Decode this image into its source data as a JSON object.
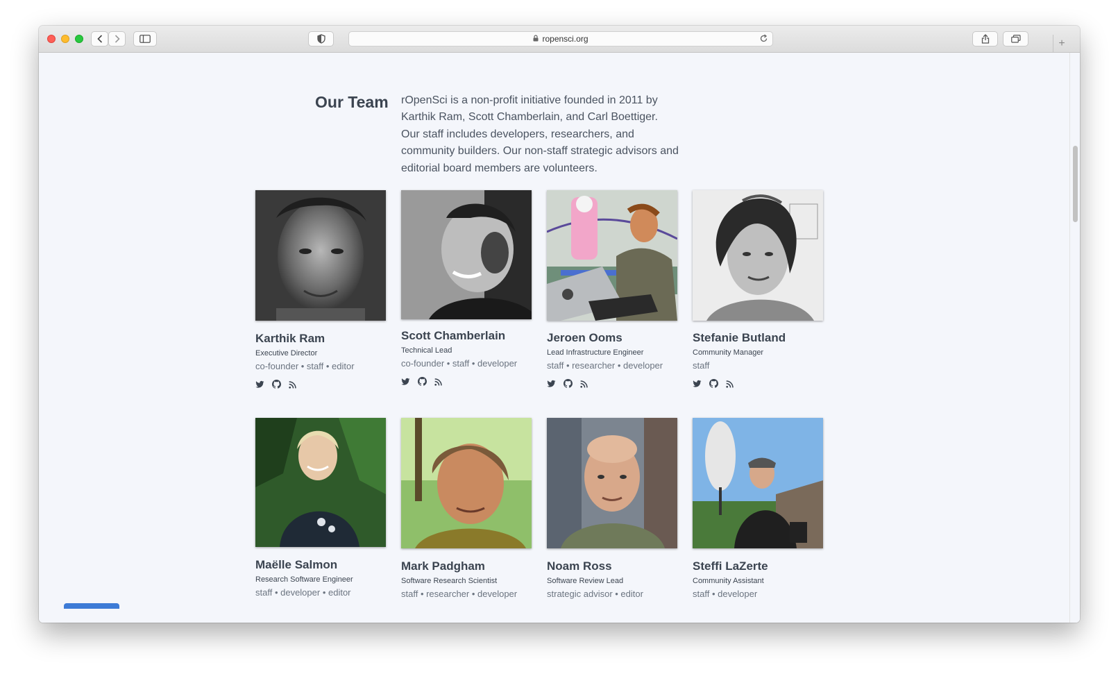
{
  "browser": {
    "url": "ropensci.org"
  },
  "team": {
    "heading": "Our Team",
    "intro": "rOpenSci is a non-profit initiative founded in 2011 by Karthik Ram, Scott Chamberlain, and Carl Boettiger. Our staff includes developers, researchers, and community builders. Our non-staff strategic advisors and editorial board members are volunteers."
  },
  "members": [
    {
      "name": "Karthik Ram",
      "role": "Executive Director",
      "tags": "co-founder • staff • editor",
      "photo_tone": "bw",
      "socials": [
        "twitter-icon",
        "github-icon",
        "rss-icon"
      ]
    },
    {
      "name": "Scott Chamberlain",
      "role": "Technical Lead",
      "tags": "co-founder • staff • developer",
      "photo_tone": "bw",
      "socials": [
        "twitter-icon",
        "github-icon",
        "rss-icon"
      ]
    },
    {
      "name": "Jeroen Ooms",
      "role": "Lead Infrastructure Engineer",
      "tags": "staff • researcher • developer",
      "photo_tone": "color",
      "socials": [
        "twitter-icon",
        "github-icon",
        "rss-icon"
      ]
    },
    {
      "name": "Stefanie Butland",
      "role": "Community Manager",
      "tags": "staff",
      "photo_tone": "bw",
      "socials": [
        "twitter-icon",
        "github-icon",
        "rss-icon"
      ]
    },
    {
      "name": "Maëlle Salmon",
      "role": "Research Software Engineer",
      "tags": "staff • developer • editor",
      "photo_tone": "color"
    },
    {
      "name": "Mark Padgham",
      "role": "Software Research Scientist",
      "tags": "staff • researcher • developer",
      "photo_tone": "color"
    },
    {
      "name": "Noam Ross",
      "role": "Software Review Lead",
      "tags": "strategic advisor • editor",
      "photo_tone": "color"
    },
    {
      "name": "Steffi LaZerte",
      "role": "Community Assistant",
      "tags": "staff • developer",
      "photo_tone": "color"
    }
  ]
}
